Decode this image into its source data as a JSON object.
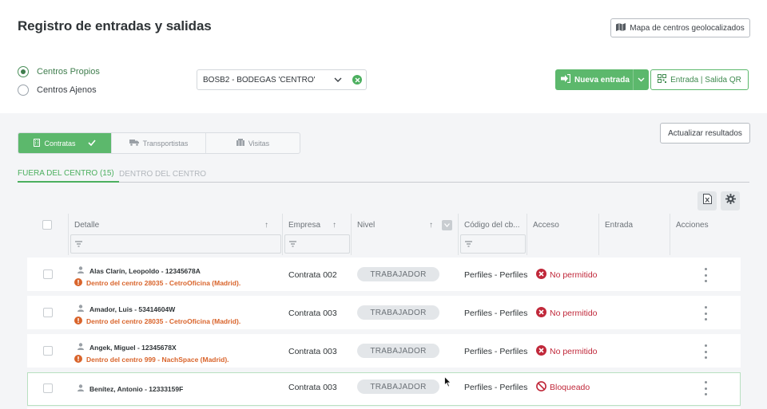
{
  "header": {
    "title": "Registro de entradas y salidas",
    "map_button": "Mapa de centros geolocalizados"
  },
  "filters": {
    "radio_options": [
      {
        "label": "Centros Propios",
        "selected": true
      },
      {
        "label": "Centros Ajenos",
        "selected": false
      }
    ],
    "center_select": "BOSB2 - BODEGAS 'CENTRO'",
    "new_entry_button": "Nueva entrada",
    "qr_button": "Entrada | Salida QR",
    "refresh_button": "Actualizar resultados"
  },
  "segments": [
    {
      "label": "Contratas",
      "active": true
    },
    {
      "label": "Transportistas",
      "active": false
    },
    {
      "label": "Visitas",
      "active": false
    }
  ],
  "tabs": [
    {
      "label": "FUERA DEL CENTRO (15)",
      "active": true
    },
    {
      "label": "DENTRO DEL CENTRO",
      "active": false
    }
  ],
  "table": {
    "columns": {
      "detalle": "Detalle",
      "empresa": "Empresa",
      "nivel": "Nivel",
      "codigo": "Código del cb...",
      "acceso": "Acceso",
      "entrada": "Entrada",
      "acciones": "Acciones"
    },
    "rows": [
      {
        "name": "Alas Clarín, Leopoldo - 12345678A",
        "warning": "Dentro del centro 28035 - CetroOficina (Madrid).",
        "empresa": "Contrata 002",
        "nivel": "TRABAJADOR",
        "codigo": "Perfiles - Perfiles",
        "acceso": "No permitido",
        "acceso_icon": "x-circle-icon"
      },
      {
        "name": "Amador, Luis - 53414604W",
        "warning": "Dentro del centro 28035 - CetroOficina (Madrid).",
        "empresa": "Contrata 003",
        "nivel": "TRABAJADOR",
        "codigo": "Perfiles - Perfiles",
        "acceso": "No permitido",
        "acceso_icon": "x-circle-icon"
      },
      {
        "name": "Angek, Miguel - 12345678X",
        "warning": "Dentro del centro 999 - NachSpace (Madrid).",
        "empresa": "Contrata 003",
        "nivel": "TRABAJADOR",
        "codigo": "Perfiles - Perfiles",
        "acceso": "No permitido",
        "acceso_icon": "x-circle-icon"
      },
      {
        "name": "Benítez, Antonio - 12333159F",
        "warning": "",
        "empresa": "Contrata 003",
        "nivel": "TRABAJADOR",
        "codigo": "Perfiles - Perfiles",
        "acceso": "Bloqueado",
        "acceso_icon": "blocked-icon"
      }
    ]
  },
  "colors": {
    "accent_green": "#5cb86c",
    "warning_orange": "#d9642b",
    "error_red": "#c0283a"
  }
}
